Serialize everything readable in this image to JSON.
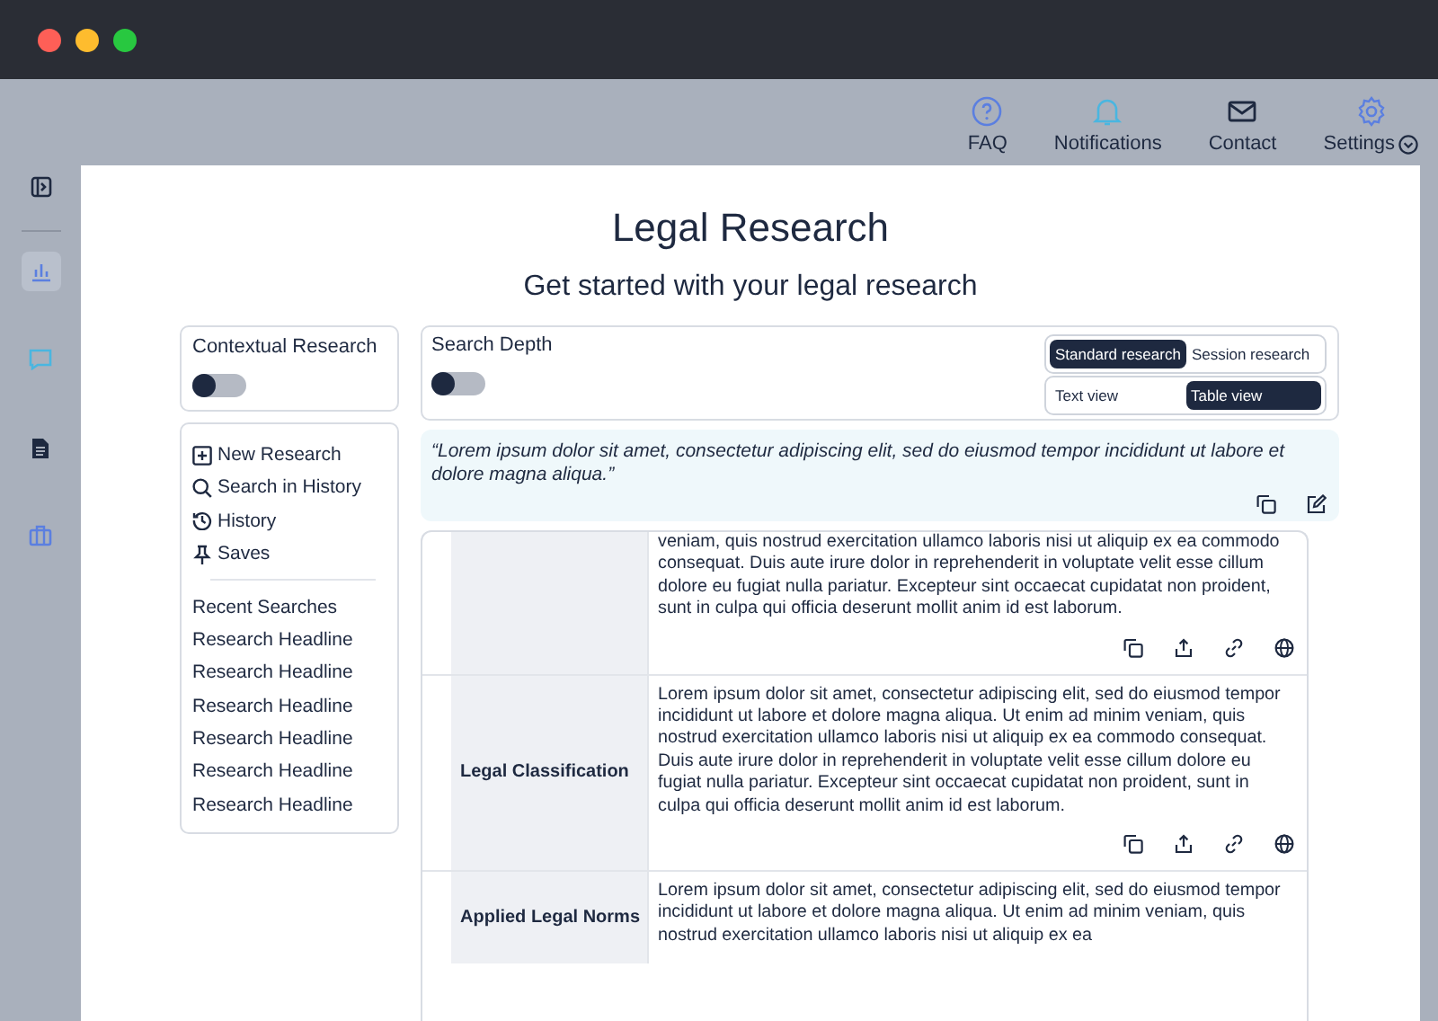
{
  "header_nav": [
    {
      "label": "FAQ"
    },
    {
      "label": "Notifications"
    },
    {
      "label": "Contact"
    },
    {
      "label": "Settings",
      "dropdown": true
    }
  ],
  "rail_items": [
    {
      "selected": true
    },
    {
      "selected": false
    },
    {
      "selected": false
    },
    {
      "selected": false
    }
  ],
  "page": {
    "title": "Legal Research",
    "subtitle": "Get started with your legal research"
  },
  "contextual_research": {
    "label": "Contextual Research",
    "on": false
  },
  "search_depth": {
    "label": "Search Depth",
    "on": false
  },
  "mode_tabs": [
    {
      "label": "Standard research",
      "selected": true
    },
    {
      "label": "Session research",
      "selected": false
    }
  ],
  "view_tabs": [
    {
      "label": "Text view",
      "selected": false
    },
    {
      "label": "Table view",
      "selected": true
    }
  ],
  "menu": [
    {
      "label": "New Research"
    },
    {
      "label": "Search in History"
    },
    {
      "label": "History"
    },
    {
      "label": "Saves"
    }
  ],
  "recent_searches": {
    "title": "Recent Searches",
    "items": [
      "Research Headline",
      "Research Headline",
      "Research Headline",
      "Research Headline",
      "Research Headline",
      "Research Headline"
    ]
  },
  "quote": "“Lorem ipsum dolor sit amet, consectetur adipiscing elit, sed do eiusmod tempor incididunt ut labore et dolore magna aliqua.”",
  "table_rows": [
    {
      "text": "veniam, quis nostrud exercitation ullamco laboris nisi ut aliquip ex ea commodo consequat. Duis aute irure dolor in reprehenderit in voluptate velit esse cillum dolore eu fugiat nulla pariatur. Excepteur sint occaecat cupidatat non proident, sunt in culpa qui officia deserunt mollit anim id est laborum.",
      "actions": true
    },
    {
      "label": "Legal Classification",
      "text": "Lorem ipsum dolor sit amet, consectetur adipiscing elit, sed do eiusmod tempor incididunt ut labore et dolore magna aliqua. Ut enim ad minim veniam, quis nostrud exercitation ullamco laboris nisi ut aliquip ex ea commodo consequat. Duis aute irure dolor in reprehenderit in voluptate velit esse cillum dolore eu fugiat nulla pariatur. Excepteur sint occaecat cupidatat non proident, sunt in culpa qui officia deserunt mollit anim id est laborum.",
      "actions": true
    },
    {
      "label": "Applied Legal Norms",
      "text": "Lorem ipsum dolor sit amet, consectetur adipiscing elit, sed do eiusmod tempor incididunt ut labore et dolore magna aliqua. Ut enim ad minim veniam, quis nostrud exercitation ullamco laboris nisi ut aliquip ex ea",
      "actions": false
    }
  ]
}
